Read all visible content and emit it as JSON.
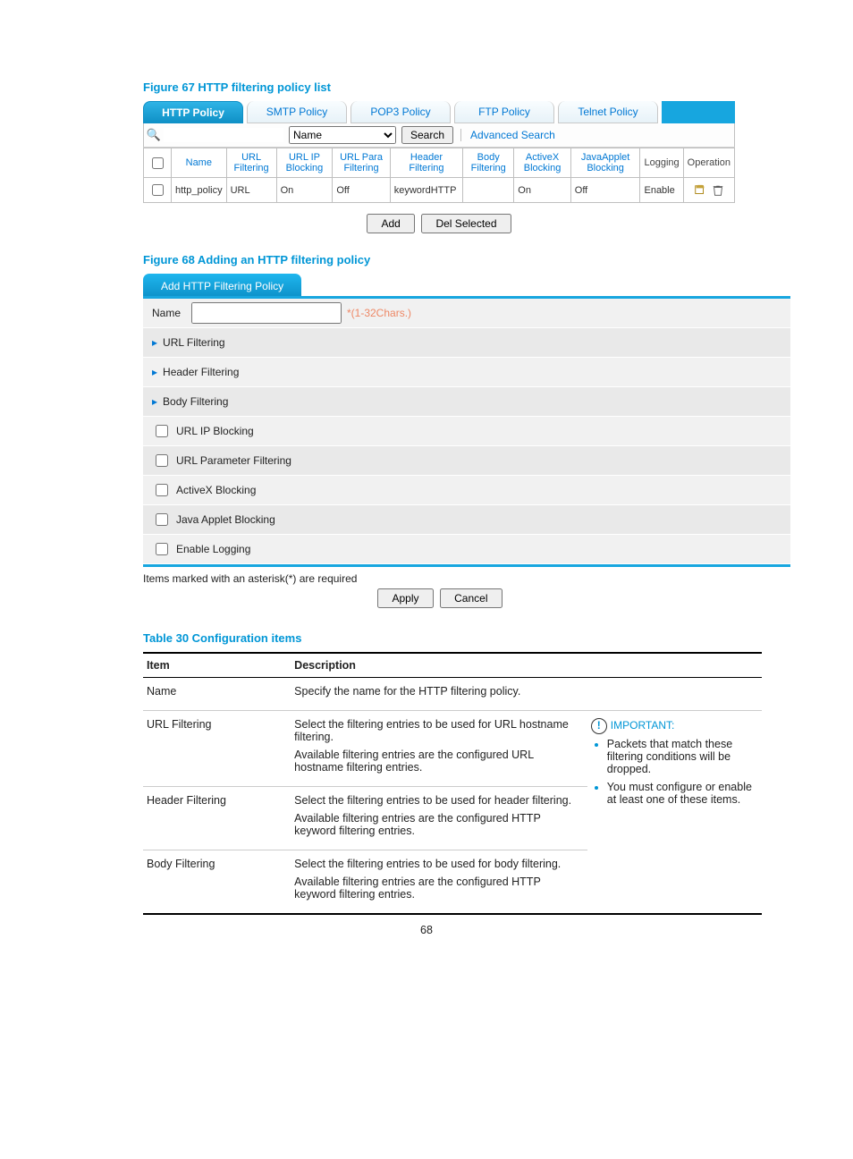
{
  "captions": {
    "fig67": "Figure 67 HTTP filtering policy list",
    "fig68": "Figure 68 Adding an HTTP filtering policy",
    "tbl30": "Table 30 Configuration items"
  },
  "tabs": [
    "HTTP Policy",
    "SMTP Policy",
    "POP3 Policy",
    "FTP Policy",
    "Telnet Policy"
  ],
  "search": {
    "field_selected": "Name",
    "search_btn": "Search",
    "advanced": "Advanced Search"
  },
  "grid": {
    "headers": [
      "",
      "Name",
      "URL Filtering",
      "URL IP Blocking",
      "URL Para Filtering",
      "Header Filtering",
      "Body Filtering",
      "ActiveX Blocking",
      "JavaApplet Blocking",
      "Logging",
      "Operation"
    ],
    "row": {
      "name": "http_policy",
      "url_filtering": "URL",
      "url_ip_blocking": "On",
      "url_para": "Off",
      "header": "keywordHTTP",
      "body": "",
      "activex": "On",
      "java": "Off",
      "logging": "Enable"
    },
    "buttons": {
      "add": "Add",
      "del": "Del Selected"
    }
  },
  "panel": {
    "title": "Add HTTP Filtering Policy",
    "name_label": "Name",
    "name_hint": "*(1-32Chars.)",
    "rows": {
      "url_filtering": "URL Filtering",
      "header_filtering": "Header Filtering",
      "body_filtering": "Body Filtering",
      "url_ip_blocking": "URL IP Blocking",
      "url_param_filtering": "URL Parameter Filtering",
      "activex_blocking": "ActiveX Blocking",
      "java_blocking": "Java Applet Blocking",
      "enable_logging": "Enable Logging"
    },
    "note": "Items marked with an asterisk(*) are required",
    "apply": "Apply",
    "cancel": "Cancel"
  },
  "cfg": {
    "header_item": "Item",
    "header_desc": "Description",
    "rows": [
      {
        "item": "Name",
        "desc": [
          "Specify the name for the HTTP filtering policy."
        ]
      },
      {
        "item": "URL Filtering",
        "desc": [
          "Select the filtering entries to be used for URL hostname filtering.",
          "Available filtering entries are the configured URL hostname filtering entries."
        ]
      },
      {
        "item": "Header Filtering",
        "desc": [
          "Select the filtering entries to be used for header filtering.",
          "Available filtering entries are the configured HTTP keyword filtering entries."
        ]
      },
      {
        "item": "Body Filtering",
        "desc": [
          "Select the filtering entries to be used for body filtering.",
          "Available filtering entries are the configured HTTP keyword filtering entries."
        ]
      }
    ],
    "important": {
      "label": "IMPORTANT:",
      "bullets": [
        "Packets that match these filtering conditions will be dropped.",
        "You must configure or enable at least one of these items."
      ]
    }
  },
  "page_number": "68"
}
